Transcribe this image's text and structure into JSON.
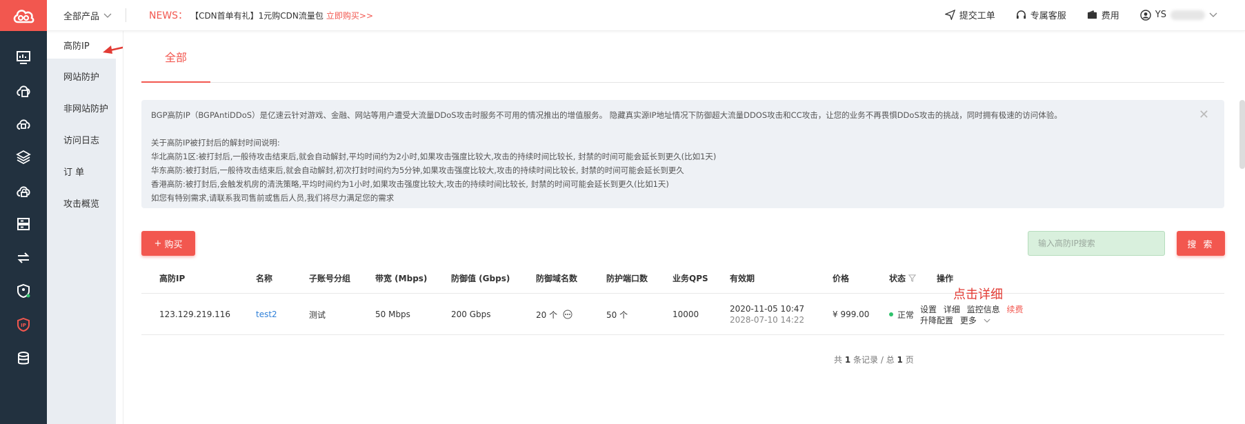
{
  "topbar": {
    "products_label": "全部产品",
    "news_label": "NEWS：",
    "news_text": "【CDN首单有礼】1元购CDN流量包",
    "news_link": "立即购买>>",
    "right_items": [
      "提交工单",
      "专属客服",
      "费用"
    ],
    "user_name": "YS"
  },
  "rail": {
    "icons": [
      "monitor-icon",
      "cloud-doc-icon",
      "cloud-gear-icon",
      "box-icon",
      "cloud-lock-icon",
      "server-icon",
      "sync-icon",
      "shield-user-icon",
      "ip-shield-icon",
      "database-icon"
    ]
  },
  "subnav": {
    "items": [
      "高防IP",
      "网站防护",
      "非网站防护",
      "访问日志",
      "订  单",
      "攻击概览"
    ]
  },
  "main": {
    "tab": "全部",
    "notice": {
      "line1": "BGP高防IP（BGPAntiDDoS）是亿速云针对游戏、金融、网站等用户遭受大流量DDoS攻击时服务不可用的情况推出的增值服务。 隐藏真实源IP地址情况下防御超大流量DDOS攻击和CC攻击，让您的业务不再畏惧DDoS攻击的挑战，同时拥有极速的访问体验。",
      "line2": "关于高防IP被打封后的解封时间说明:",
      "line3": "华北高防1区:被打封后,一般待攻击结束后,就会自动解封,平均时间约为2小时,如果攻击强度比较大,攻击的持续时间比较长, 封禁的时间可能会延长到更久(比如1天)",
      "line4": "华东高防:被打封后,一般待攻击结束后,就会自动解封,初次打封时间约为5分钟,如果攻击强度比较大,攻击的持续时间比较长, 封禁的时间可能会延长到更久",
      "line5": "香港高防:被打封后,会触发机房的清洗策略,平均时间约为1小时,如果攻击强度比较大,攻击的持续时间比较长, 封禁的时间可能会延长到更久(比如1天)",
      "line6": "如您有特别需求,请联系我司售前或售后人员,我们将尽力满足您的需求"
    },
    "buy_label": "购买",
    "search_placeholder": "输入高防IP搜索",
    "search_button": "搜 索",
    "columns": {
      "ip": "高防IP",
      "name": "名称",
      "group": "子账号分组",
      "bandwidth": "带宽 (Mbps)",
      "defense": "防御值 (Gbps)",
      "domains": "防御域名数",
      "ports": "防护端口数",
      "qps": "业务QPS",
      "validity": "有效期",
      "price": "价格",
      "status": "状态",
      "actions": "操作"
    },
    "row": {
      "ip": "123.129.219.116",
      "name": "test2",
      "group": "测试",
      "bandwidth": "50 Mbps",
      "defense": "200 Gbps",
      "domains": "20 个",
      "ports": "50 个",
      "qps": "10000",
      "start": "2020-11-05 10:47",
      "end": "2028-07-10 14:22",
      "price": "¥ 999.00",
      "status": "正常",
      "actions": [
        "设置",
        "详细",
        "监控信息",
        "续费"
      ],
      "actions2": [
        "升降配置",
        "更多"
      ]
    },
    "annotation": "点击详细",
    "pager": {
      "prefix": "共",
      "records": "1",
      "mid": "条记录 / 总",
      "pages": "1",
      "suffix": "页"
    }
  }
}
